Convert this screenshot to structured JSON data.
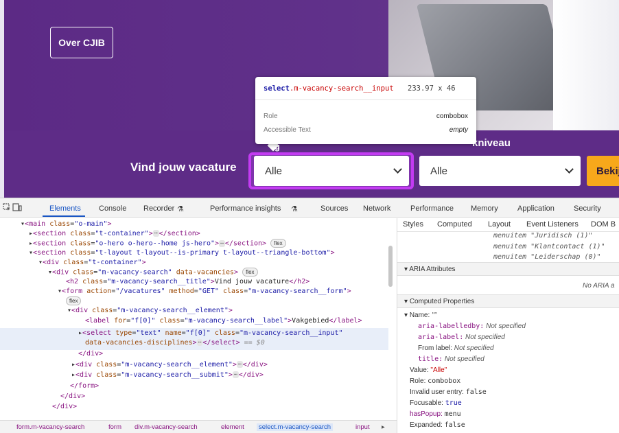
{
  "site": {
    "over_button": "Over CJIB",
    "vacancy_title": "Vind jouw vacature",
    "label_frag": "g",
    "label2": "kniveau",
    "select1_value": "Alle",
    "select2_value": "Alle",
    "submit_label": "Bekij"
  },
  "tooltip": {
    "selector_tag": "select",
    "selector_class": ".m-vacancy-search__input",
    "dimensions": "233.97 x 46",
    "role_label": "Role",
    "role_value": "combobox",
    "accessible_label": "Accessible Text",
    "accessible_value": "empty"
  },
  "devtools": {
    "tabs": [
      "Elements",
      "Console",
      "Recorder",
      "Performance insights",
      "Sources",
      "Network",
      "Performance",
      "Memory",
      "Application",
      "Security"
    ],
    "side_tabs": [
      "Styles",
      "Computed",
      "Layout",
      "Event Listeners",
      "DOM B"
    ],
    "breadcrumb": [
      "form.m-vacancy-search",
      "form",
      "div.m-vacancy-search",
      "element",
      "select.m-vacancy-search",
      "input"
    ],
    "aria": {
      "menuitems": [
        "menuitem \"Juridisch (1)\"",
        "menuitem \"Klantcontact (1)\"",
        "menuitem \"Leiderschap (0)\""
      ],
      "aria_attributes_header": "ARIA Attributes",
      "no_aria": "No ARIA a",
      "computed_header": "Computed Properties",
      "name_label": "Name:",
      "name_value": "\"\"",
      "labelledby_key": "aria-labelledby:",
      "labelledby_val": "Not specified",
      "label_key": "aria-label:",
      "label_val": "Not specified",
      "from_label_key": "From label:",
      "from_label_val": "Not specified",
      "title_key": "title:",
      "title_val": "Not specified",
      "value_key": "Value:",
      "value_val": "\"Alle\"",
      "role_key": "Role:",
      "role_val": "combobox",
      "invalid_key": "Invalid user entry:",
      "invalid_val": "false",
      "focusable_key": "Focusable:",
      "focusable_val": "true",
      "haspopup_key": "hasPopup:",
      "haspopup_val": "menu",
      "expanded_key": "Expanded:",
      "expanded_val": "false"
    },
    "dom": {
      "l1_tag": "main",
      "l1_class": "o-main",
      "l2_tag": "section",
      "l2_class": "t-container",
      "l3_tag": "section",
      "l3_class": "o-hero o-hero--home js-hero",
      "l4_tag": "section",
      "l4_class": "t-layout t-layout--is-primary t-layout--triangle-bottom",
      "l5_tag": "div",
      "l5_class": "t-container",
      "l6_tag": "div",
      "l6_class": "m-vacancy-search",
      "l6_attr": "data-vacancies",
      "l7_tag": "h2",
      "l7_class": "m-vacancy-search__title",
      "l7_text": "Vind jouw vacature",
      "l8_tag": "form",
      "l8_action": "/vacatures",
      "l8_method": "GET",
      "l8_class": "m-vacancy-search__form",
      "l9_tag": "div",
      "l9_class": "m-vacancy-search__element",
      "l10_tag": "label",
      "l10_for": "f[0]",
      "l10_class": "m-vacancy-search__label",
      "l10_text": "Vakgebied",
      "l11_tag": "select",
      "l11_type": "text",
      "l11_name": "f[0]",
      "l11_class": "m-vacancy-search__input",
      "l11_attr": "data-vacancies-disciplines",
      "l11_dollar": "== $0",
      "l12_tag": "div",
      "l13_class": "m-vacancy-search__element",
      "l14_class": "m-vacancy-search__submit",
      "close_form": "form",
      "close_div": "div",
      "badge_flex": "flex",
      "ellipsis": "⋯"
    }
  }
}
